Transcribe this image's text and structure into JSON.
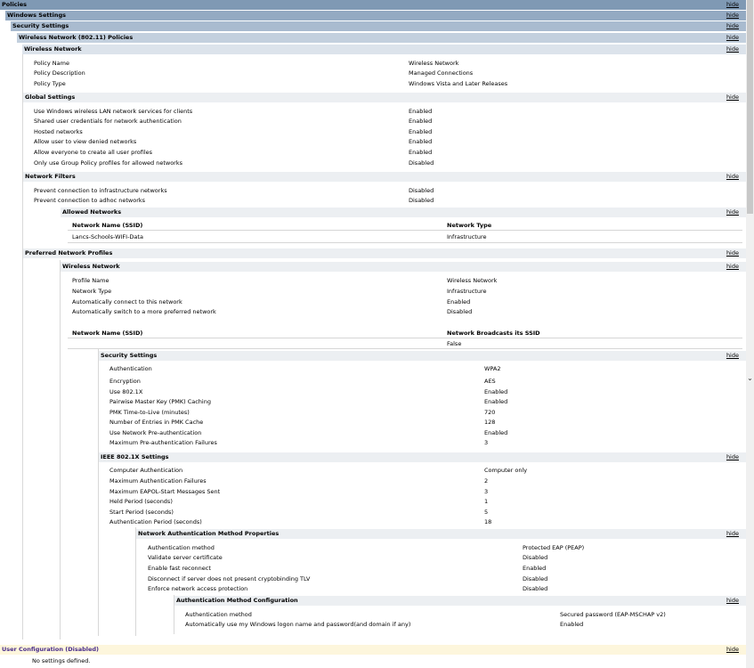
{
  "headers": {
    "policies": "Policies",
    "windows_settings": "Windows Settings",
    "security_settings": "Security Settings",
    "wireless_policies": "Wireless Network (802.11) Policies",
    "wireless_network": "Wireless Network",
    "global_settings": "Global Settings",
    "network_filters": "Network Filters",
    "allowed_networks": "Allowed Networks",
    "preferred_profiles": "Preferred Network Profiles",
    "profile_wireless_network": "Wireless Network",
    "profile_security_settings": "Security Settings",
    "ieee_settings": "IEEE 802.1X Settings",
    "nam_properties": "Network Authentication Method Properties",
    "amc": "Authentication Method Configuration",
    "user_configuration": "User Configuration (Disabled)"
  },
  "hide_label": "hide",
  "wireless_network_rows": [
    {
      "label": "Policy Name",
      "value": "Wireless Network"
    },
    {
      "label": "Policy Description",
      "value": "Managed Connections"
    },
    {
      "label": "Policy Type",
      "value": "Windows Vista and Later Releases"
    }
  ],
  "global_settings_rows": [
    {
      "label": "Use Windows wireless LAN network services for clients",
      "value": "Enabled"
    },
    {
      "label": "Shared user credentials for network authentication",
      "value": "Enabled"
    },
    {
      "label": "Hosted networks",
      "value": "Enabled"
    },
    {
      "label": "Allow user to view denied networks",
      "value": "Enabled"
    },
    {
      "label": "Allow everyone to create all user profiles",
      "value": "Enabled"
    },
    {
      "label": "Only use Group Policy profiles for allowed networks",
      "value": "Disabled"
    }
  ],
  "network_filters_rows": [
    {
      "label": "Prevent connection to infrastructure networks",
      "value": "Disabled"
    },
    {
      "label": "Prevent connection to adhoc networks",
      "value": "Disabled"
    }
  ],
  "allowed_networks": {
    "col_ssid": "Network Name (SSID)",
    "col_type": "Network Type",
    "rows": [
      {
        "ssid": "Lancs-Schools-WIFI-Data",
        "type": "Infrastructure"
      }
    ]
  },
  "profile_rows": [
    {
      "label": "Profile Name",
      "value": "Wireless Network"
    },
    {
      "label": "Network Type",
      "value": "Infrastructure"
    },
    {
      "label": "Automatically connect to this network",
      "value": "Enabled"
    },
    {
      "label": "Automatically switch to a more preferred network",
      "value": "Disabled"
    }
  ],
  "ssid_table": {
    "col_ssid": "Network Name (SSID)",
    "col_broadcast": "Network Broadcasts its SSID",
    "rows": [
      {
        "ssid": "",
        "broadcast": "False"
      }
    ]
  },
  "security_rows": [
    {
      "label": "Authentication",
      "value": "WPA2"
    },
    {
      "label": "Encryption",
      "value": "AES"
    },
    {
      "label": "Use 802.1X",
      "value": "Enabled"
    },
    {
      "label": "Pairwise Master Key (PMK) Caching",
      "value": "Enabled"
    },
    {
      "label": "PMK Time-to-Live (minutes)",
      "value": "720"
    },
    {
      "label": "Number of Entries in PMK Cache",
      "value": "128"
    },
    {
      "label": "Use Network Pre-authentication",
      "value": "Enabled"
    },
    {
      "label": "Maximum Pre-authentication Failures",
      "value": "3"
    }
  ],
  "ieee_rows": [
    {
      "label": "Computer Authentication",
      "value": "Computer only"
    },
    {
      "label": "Maximum Authentication Failures",
      "value": "2"
    },
    {
      "label": "Maximum EAPOL-Start Messages Sent",
      "value": "3"
    },
    {
      "label": "Held Period (seconds)",
      "value": "1"
    },
    {
      "label": "Start Period (seconds)",
      "value": "5"
    },
    {
      "label": "Authentication Period (seconds)",
      "value": "18"
    }
  ],
  "nam_rows": [
    {
      "label": "Authentication method",
      "value": "Protected EAP (PEAP)"
    },
    {
      "label": "Validate server certificate",
      "value": "Disabled"
    },
    {
      "label": "Enable fast reconnect",
      "value": "Enabled"
    },
    {
      "label": "Disconnect if server does not present cryptobinding TLV",
      "value": "Disabled"
    },
    {
      "label": "Enforce network access protection",
      "value": "Disabled"
    }
  ],
  "amc_rows": [
    {
      "label": "Authentication method",
      "value": "Secured password (EAP-MSCHAP v2)"
    },
    {
      "label": "Automatically use my Windows logon name and password(and domain if any)",
      "value": "Enabled"
    }
  ],
  "user_config_text": "No settings defined."
}
